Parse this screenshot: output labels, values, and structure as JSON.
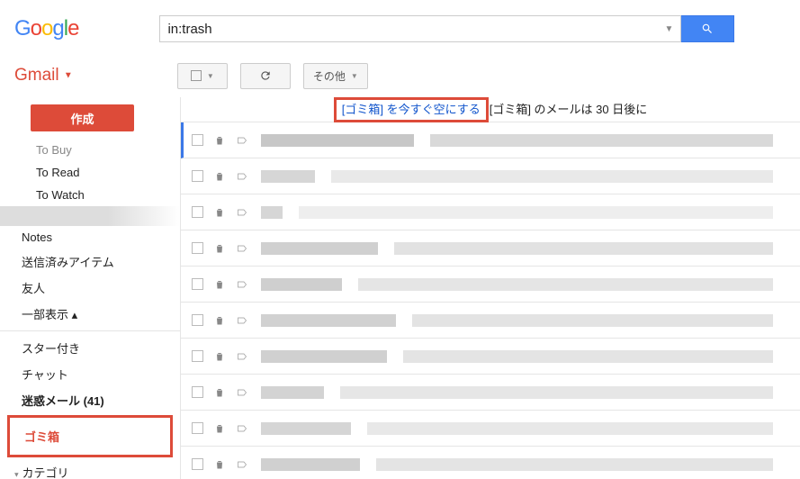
{
  "header": {
    "logo_text": "Google",
    "search_value": "in:trash"
  },
  "subheader": {
    "gmail_label": "Gmail",
    "more_label": "その他"
  },
  "sidebar": {
    "compose": "作成",
    "items": {
      "tobuy": "To Buy",
      "toread": "To Read",
      "towatch": "To Watch",
      "notes": "Notes",
      "sent": "送信済みアイテム",
      "friends": "友人",
      "show": "一部表示",
      "starred": "スター付き",
      "chat": "チャット",
      "spam": "迷惑メール (41)",
      "trash": "ゴミ箱",
      "category": "カテゴリ"
    }
  },
  "banner": {
    "link": "[ゴミ箱] を今すぐ空にする",
    "text": "[ゴミ箱] のメールは 30 日後に"
  },
  "mail_rows": [
    {
      "sw": 170,
      "swc": "#c7c7c7",
      "sjc": "#d9d9d9"
    },
    {
      "sw": 60,
      "swc": "#d6d6d6",
      "sjc": "#e9e9e9"
    },
    {
      "sw": 24,
      "swc": "#d6d6d6",
      "sjc": "#eee"
    },
    {
      "sw": 130,
      "swc": "#d0d0d0",
      "sjc": "#e2e2e2"
    },
    {
      "sw": 90,
      "swc": "#cfcfcf",
      "sjc": "#e5e5e5"
    },
    {
      "sw": 150,
      "swc": "#d1d1d1",
      "sjc": "#e3e3e3"
    },
    {
      "sw": 140,
      "swc": "#d0d0d0",
      "sjc": "#e4e4e4"
    },
    {
      "sw": 70,
      "swc": "#d3d3d3",
      "sjc": "#e6e6e6"
    },
    {
      "sw": 100,
      "swc": "#d5d5d5",
      "sjc": "#e8e8e8"
    },
    {
      "sw": 110,
      "swc": "#d0d0d0",
      "sjc": "#e4e4e4"
    }
  ]
}
